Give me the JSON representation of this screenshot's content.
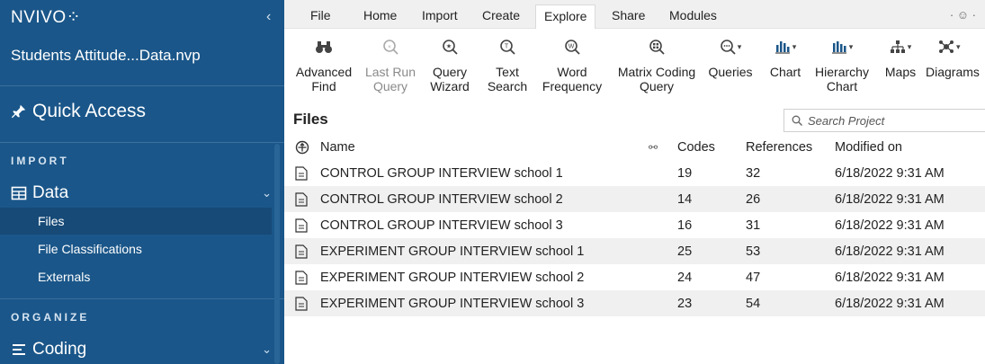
{
  "app": {
    "logo": "NVIVO",
    "logo_mark": "⁘",
    "project": "Students Attitude...Data.nvp",
    "quick_access": "Quick Access"
  },
  "sidebar": {
    "import_label": "IMPORT",
    "data_group": "Data",
    "items": [
      {
        "label": "Files"
      },
      {
        "label": "File Classifications"
      },
      {
        "label": "Externals"
      }
    ],
    "organize_label": "ORGANIZE",
    "coding_group": "Coding"
  },
  "ribbon": {
    "tabs": [
      "File",
      "Home",
      "Import",
      "Create",
      "Explore",
      "Share",
      "Modules"
    ],
    "active_tab": "Explore",
    "buttons": [
      {
        "line1": "Advanced",
        "line2": "Find",
        "icon": "binoculars-icon"
      },
      {
        "line1": "Last Run",
        "line2": "Query",
        "icon": "last-run-icon"
      },
      {
        "line1": "Query",
        "line2": "Wizard",
        "icon": "query-wizard-icon"
      },
      {
        "line1": "Text",
        "line2": "Search",
        "icon": "text-search-icon"
      },
      {
        "line1": "Word",
        "line2": "Frequency",
        "icon": "word-frequency-icon"
      },
      {
        "line1": "Matrix Coding",
        "line2": "Query",
        "icon": "matrix-coding-icon"
      },
      {
        "line1": "Queries",
        "line2": "",
        "icon": "queries-icon"
      },
      {
        "line1": "Chart",
        "line2": "",
        "icon": "chart-icon"
      },
      {
        "line1": "Hierarchy",
        "line2": "Chart",
        "icon": "hierarchy-chart-icon"
      },
      {
        "line1": "Maps",
        "line2": "",
        "icon": "maps-icon"
      },
      {
        "line1": "Diagrams",
        "line2": "",
        "icon": "diagrams-icon"
      }
    ]
  },
  "files": {
    "title": "Files",
    "search_placeholder": "Search Project",
    "columns": {
      "name": "Name",
      "codes": "Codes",
      "references": "References",
      "modified": "Modified on"
    },
    "rows": [
      {
        "name": "CONTROL GROUP INTERVIEW school 1",
        "codes": "19",
        "references": "32",
        "modified": "6/18/2022 9:31 AM"
      },
      {
        "name": "CONTROL GROUP INTERVIEW school 2",
        "codes": "14",
        "references": "26",
        "modified": "6/18/2022 9:31 AM"
      },
      {
        "name": "CONTROL GROUP INTERVIEW school 3",
        "codes": "16",
        "references": "31",
        "modified": "6/18/2022 9:31 AM"
      },
      {
        "name": "EXPERIMENT GROUP INTERVIEW school 1",
        "codes": "25",
        "references": "53",
        "modified": "6/18/2022 9:31 AM"
      },
      {
        "name": "EXPERIMENT GROUP INTERVIEW school 2",
        "codes": "24",
        "references": "47",
        "modified": "6/18/2022 9:31 AM"
      },
      {
        "name": "EXPERIMENT GROUP INTERVIEW school 3",
        "codes": "23",
        "references": "54",
        "modified": "6/18/2022 9:31 AM"
      }
    ]
  },
  "colors": {
    "sidebar": "#1a5689",
    "active_item": "#174a77",
    "row_alt": "#f0f0f0"
  }
}
